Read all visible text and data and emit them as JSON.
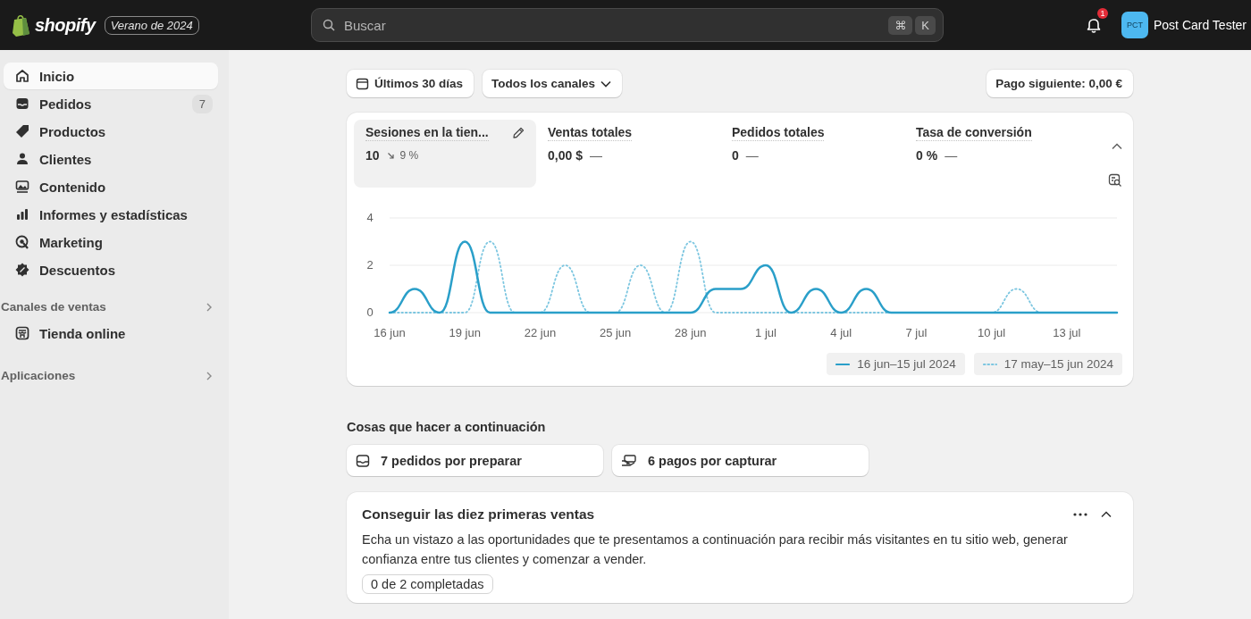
{
  "topbar": {
    "logo_text": "shopify",
    "edition": "Verano de 2024",
    "search": {
      "placeholder": "Buscar"
    },
    "shortcut_keys": [
      "⌘",
      "K"
    ],
    "notification_count": "1",
    "store": {
      "initials": "PCT",
      "name": "Post Card Tester"
    }
  },
  "sidebar": {
    "items": [
      {
        "label": "Inicio",
        "selected": true
      },
      {
        "label": "Pedidos",
        "selected": false,
        "badge": "7"
      },
      {
        "label": "Productos",
        "selected": false
      },
      {
        "label": "Clientes",
        "selected": false
      },
      {
        "label": "Contenido",
        "selected": false
      },
      {
        "label": "Informes y estadísticas",
        "selected": false
      },
      {
        "label": "Marketing",
        "selected": false
      },
      {
        "label": "Descuentos",
        "selected": false
      }
    ],
    "sections": [
      {
        "heading": "Canales de ventas",
        "items": [
          {
            "label": "Tienda online",
            "selected": false
          }
        ]
      },
      {
        "heading": "Aplicaciones"
      }
    ]
  },
  "filters": {
    "date_range": "Últimos 30 días",
    "channels": "Todos los canales",
    "payout": "Pago siguiente: 0,00 €"
  },
  "metrics": [
    {
      "label": "Sesiones en la tien...",
      "value": "10",
      "change": "9 %",
      "selected": true
    },
    {
      "label": "Ventas totales",
      "value": "0,00 $",
      "change": "—",
      "selected": false
    },
    {
      "label": "Pedidos totales",
      "value": "0",
      "change": "—",
      "selected": false
    },
    {
      "label": "Tasa de conversión",
      "value": "0 %",
      "change": "—",
      "selected": false
    }
  ],
  "chart_data": {
    "type": "line",
    "categories": [
      "16 jun",
      null,
      null,
      "19 jun",
      null,
      null,
      "22 jun",
      null,
      null,
      "25 jun",
      null,
      null,
      "28 jun",
      null,
      null,
      "1 jul",
      null,
      null,
      "4 jul",
      null,
      null,
      "7 jul",
      null,
      null,
      "10 jul",
      null,
      null,
      "13 jul",
      null,
      null
    ],
    "series": [
      {
        "name": "16 jun–15 jul 2024",
        "color": "#2a9fc9",
        "line_style": "solid",
        "values": [
          0,
          1,
          0,
          3,
          0,
          0,
          0,
          0,
          0,
          0,
          0,
          0,
          0,
          1,
          1,
          2,
          0,
          1,
          0,
          1,
          0,
          0,
          0,
          0,
          0,
          0,
          0,
          0,
          0,
          0
        ]
      },
      {
        "name": "17 may–15 jun 2024",
        "color": "#7cc6e0",
        "line_style": "dotted",
        "values": [
          0,
          0,
          0,
          0,
          3,
          0,
          0,
          2,
          0,
          0,
          2,
          0,
          3,
          0,
          0,
          0,
          0,
          0,
          0,
          0,
          0,
          0,
          0,
          0,
          0,
          1,
          0,
          0,
          0,
          0
        ]
      }
    ],
    "ylim": [
      0,
      4
    ],
    "yticks": [
      0,
      2,
      4
    ]
  },
  "next_steps": {
    "heading": "Cosas que hacer a continuación",
    "tasks": [
      "7 pedidos por preparar",
      "6 pagos por capturar"
    ]
  },
  "setup_card": {
    "title": "Conseguir las diez primeras ventas",
    "description": "Echa un vistazo a las oportunidades que te presentamos a continuación para recibir más visitantes en tu sitio web, generar confianza entre tus clientes y comenzar a vender.",
    "progress": "0 de 2 completadas",
    "expanded": true
  }
}
